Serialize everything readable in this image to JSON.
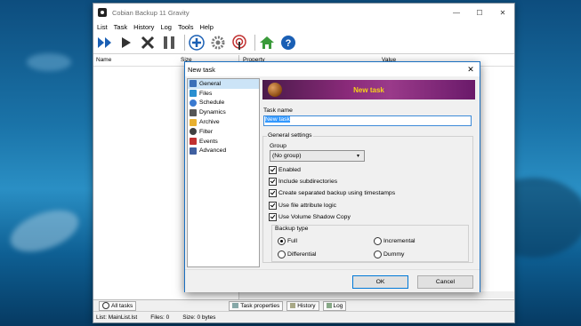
{
  "app": {
    "title": "Cobian Backup 11 Gravity",
    "window_controls": {
      "minimize": "—",
      "maximize": "☐",
      "close": "✕"
    },
    "menu": [
      "List",
      "Task",
      "History",
      "Log",
      "Tools",
      "Help"
    ],
    "toolbar": [
      "run-all-icon",
      "run-icon",
      "cancel-icon",
      "pause-icon",
      "add-task-icon",
      "settings-icon",
      "antenna-icon",
      "home-icon",
      "help-icon"
    ],
    "left_header": {
      "name": "Name",
      "size": "Size"
    },
    "right_header": {
      "property": "Property",
      "value": "Value"
    },
    "bottom_tabs": {
      "all_tasks": "All tasks",
      "task_properties": "Task properties",
      "history": "History",
      "log": "Log"
    },
    "status": {
      "list": "List: MainList.lst",
      "files": "Files: 0",
      "size": "Size: 0 bytes"
    }
  },
  "dialog": {
    "title": "New task",
    "close": "✕",
    "tree": [
      {
        "label": "General",
        "selected": true,
        "color": "#3a6fb8"
      },
      {
        "label": "Files",
        "color": "#2a8fd0"
      },
      {
        "label": "Schedule",
        "color": "#3a7ad0"
      },
      {
        "label": "Dynamics",
        "color": "#555555"
      },
      {
        "label": "Archive",
        "color": "#e8b030"
      },
      {
        "label": "Filter",
        "color": "#404040"
      },
      {
        "label": "Events",
        "color": "#c03030"
      },
      {
        "label": "Advanced",
        "color": "#4060a0"
      }
    ],
    "banner": "New task",
    "task_name_label": "Task name",
    "task_name_value": "New task",
    "general_settings": "General settings",
    "group_label": "Group",
    "group_value": "(No group)",
    "options": [
      {
        "label": "Enabled",
        "checked": true
      },
      {
        "label": "Include subdirectories",
        "checked": true
      },
      {
        "label": "Create separated backup using timestamps",
        "checked": true
      },
      {
        "label": "Use file attribute logic",
        "checked": true
      },
      {
        "label": "Use Volume Shadow Copy",
        "checked": true
      }
    ],
    "backup_type_label": "Backup type",
    "backup_types": {
      "full": "Full",
      "incremental": "Incremental",
      "differential": "Differential",
      "dummy": "Dummy"
    },
    "backup_type_selected": "Full",
    "ok": "OK",
    "cancel": "Cancel"
  }
}
